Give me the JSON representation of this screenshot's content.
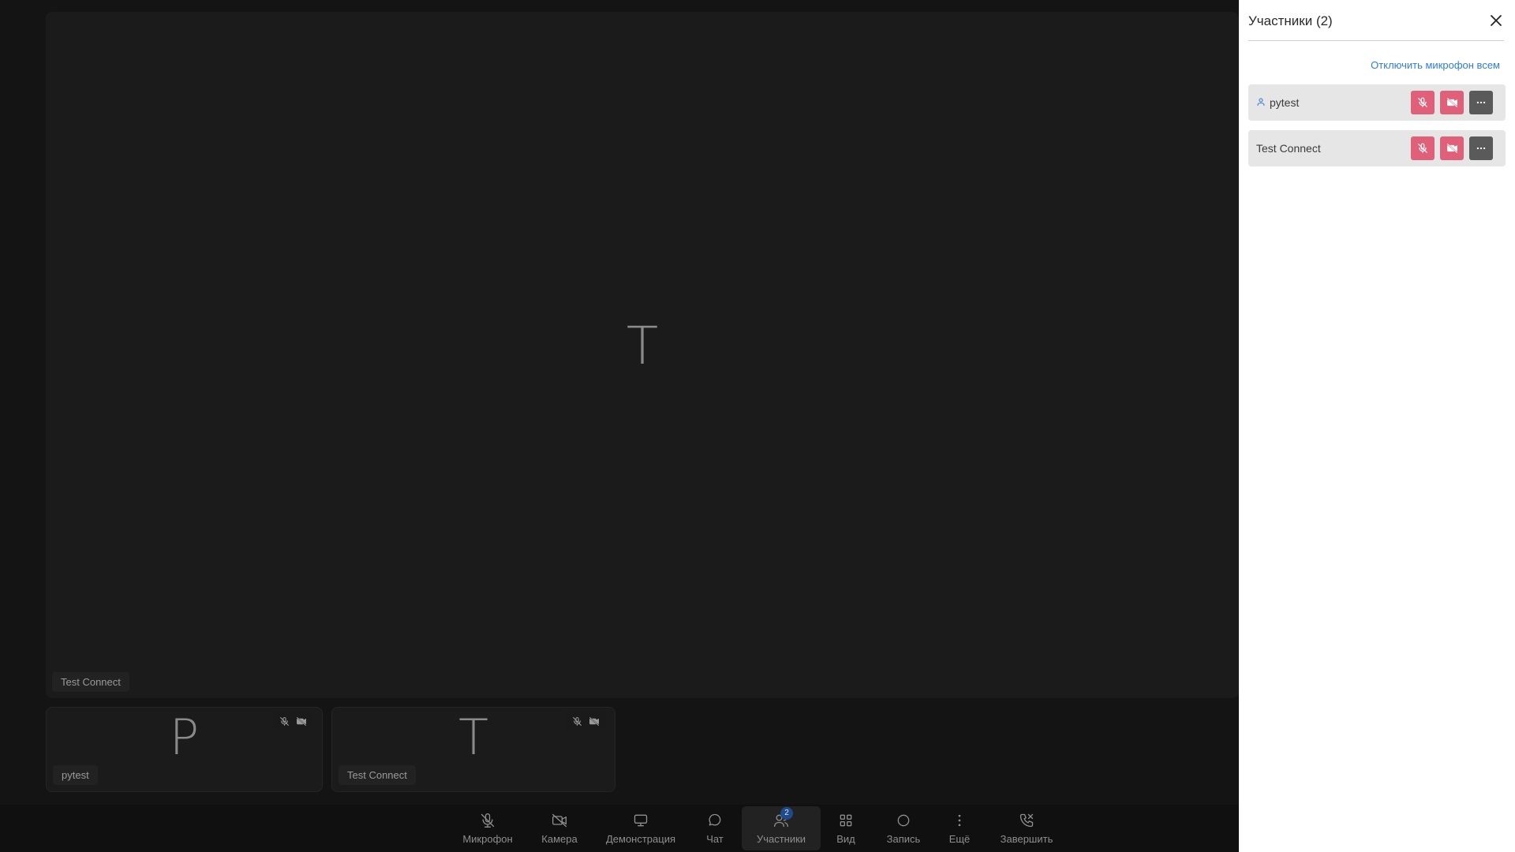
{
  "main_tile": {
    "initial": "T",
    "name": "Test Connect"
  },
  "thumbnails": [
    {
      "initial": "P",
      "name": "pytest"
    },
    {
      "initial": "T",
      "name": "Test Connect"
    }
  ],
  "toolbar": {
    "items": [
      {
        "label": "Микрофон",
        "icon": "mic-off-icon"
      },
      {
        "label": "Камера",
        "icon": "camera-off-icon"
      },
      {
        "label": "Демонстрация",
        "icon": "monitor-icon"
      },
      {
        "label": "Чат",
        "icon": "chat-icon"
      },
      {
        "label": "Участники",
        "icon": "participants-icon",
        "badge": "2",
        "active": true
      },
      {
        "label": "Вид",
        "icon": "grid-icon"
      },
      {
        "label": "Запись",
        "icon": "record-icon"
      },
      {
        "label": "Ещё",
        "icon": "more-vertical-icon"
      },
      {
        "label": "Завершить",
        "icon": "end-call-icon"
      }
    ]
  },
  "panel": {
    "title": "Участники (2)",
    "mute_all": "Отключить микрофон всем",
    "participants": [
      {
        "name": "pytest",
        "host": true
      },
      {
        "name": "Test Connect",
        "host": false
      }
    ]
  },
  "colors": {
    "accent": "#2f7ed8",
    "mute_red": "#e0607a",
    "stage_bg": "#141414"
  }
}
